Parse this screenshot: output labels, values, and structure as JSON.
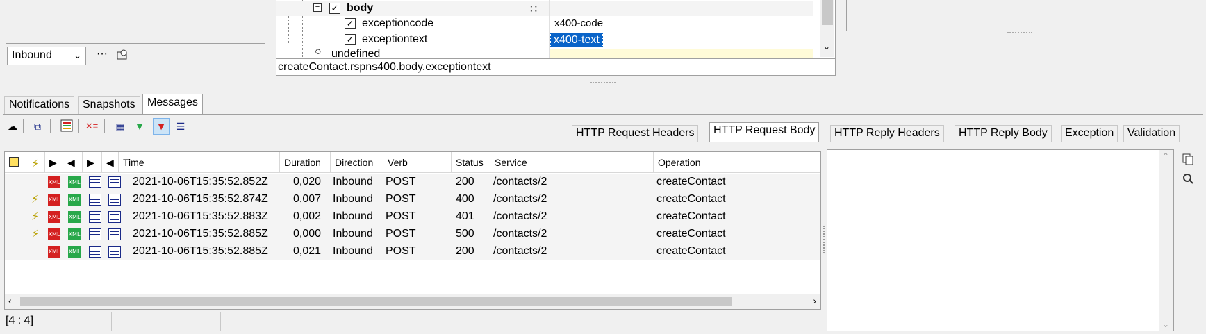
{
  "top": {
    "direction_select": "Inbound",
    "more_label": "···",
    "tree_rows": [
      {
        "label": "body",
        "bold": true
      },
      {
        "label": "exceptioncode",
        "value": "x400-code"
      },
      {
        "label": "exceptiontext",
        "value": "x400-text"
      },
      {
        "label": "undefined"
      }
    ],
    "path": "createContact.rspns400.body.exceptiontext"
  },
  "main_tabs": [
    "Notifications",
    "Snapshots",
    "Messages"
  ],
  "detail_tabs": [
    "HTTP Request Headers",
    "HTTP Request Body",
    "HTTP Reply Headers",
    "HTTP Reply Body",
    "Exception",
    "Validation"
  ],
  "grid": {
    "headers": [
      "Time",
      "Duration",
      "Direction",
      "Verb",
      "Status",
      "Service",
      "Operation"
    ],
    "rows": [
      {
        "error": false,
        "time": "2021-10-06T15:35:52.852Z",
        "duration": "0,020",
        "direction": "Inbound",
        "verb": "POST",
        "status": "200",
        "service": "/contacts/2",
        "operation": "createContact"
      },
      {
        "error": true,
        "time": "2021-10-06T15:35:52.874Z",
        "duration": "0,007",
        "direction": "Inbound",
        "verb": "POST",
        "status": "400",
        "service": "/contacts/2",
        "operation": "createContact"
      },
      {
        "error": true,
        "time": "2021-10-06T15:35:52.883Z",
        "duration": "0,002",
        "direction": "Inbound",
        "verb": "POST",
        "status": "401",
        "service": "/contacts/2",
        "operation": "createContact"
      },
      {
        "error": true,
        "time": "2021-10-06T15:35:52.885Z",
        "duration": "0,000",
        "direction": "Inbound",
        "verb": "POST",
        "status": "500",
        "service": "/contacts/2",
        "operation": "createContact"
      },
      {
        "error": false,
        "time": "2021-10-06T15:35:52.885Z",
        "duration": "0,021",
        "direction": "Inbound",
        "verb": "POST",
        "status": "200",
        "service": "/contacts/2",
        "operation": "createContact"
      }
    ],
    "xml_label": "XML"
  },
  "status_bar": {
    "position": "[4 : 4]"
  },
  "colors": {
    "selection": "#0a64c8",
    "error_bolt": "#b8a000"
  }
}
